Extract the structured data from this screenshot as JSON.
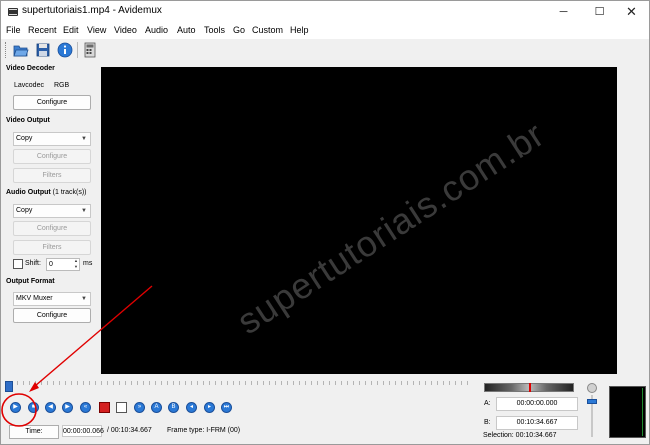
{
  "window": {
    "title": "supertutoriais1.mp4 - Avidemux",
    "minimize_glyph": "─",
    "maximize_glyph": "☐",
    "close_glyph": "✕"
  },
  "menu": [
    "File",
    "Recent",
    "Edit",
    "View",
    "Video",
    "Audio",
    "Auto",
    "Tools",
    "Go",
    "Custom",
    "Help"
  ],
  "toolbar": {
    "icons": [
      "open-folder-icon",
      "save-icon",
      "info-icon",
      "calculator-icon"
    ]
  },
  "video_decoder": {
    "title": "Video Decoder",
    "codec_label": "Lavcodec",
    "format_label": "RGB",
    "configure_label": "Configure"
  },
  "video_output": {
    "title": "Video Output",
    "codec_value": "Copy",
    "configure_label": "Configure",
    "filters_label": "Filters"
  },
  "audio_output": {
    "title": "Audio Output",
    "track_info": "(1 track(s))",
    "codec_value": "Copy",
    "configure_label": "Configure",
    "filters_label": "Filters",
    "shift_label": "Shift:",
    "shift_value": "0",
    "shift_unit": "ms"
  },
  "output_format": {
    "title": "Output Format",
    "muxer_value": "MKV Muxer",
    "configure_label": "Configure"
  },
  "watermark": "supertutoriais.com.br",
  "time": {
    "button_label": "Time:",
    "current": "00:00:00.066",
    "total": "/ 00:10:34.667",
    "frame_type": "Frame type:  I-FRM (00)"
  },
  "markers": {
    "a_label": "A:",
    "a_value": "00:00:00.000",
    "b_label": "B:",
    "b_value": "00:10:34.667",
    "selection": "Selection: 00:10:34.667"
  },
  "timeline": {
    "position_fraction": 0.0
  },
  "colors": {
    "accent": "#2b79d6",
    "annotation": "#e00000",
    "video_bg": "#000000"
  }
}
